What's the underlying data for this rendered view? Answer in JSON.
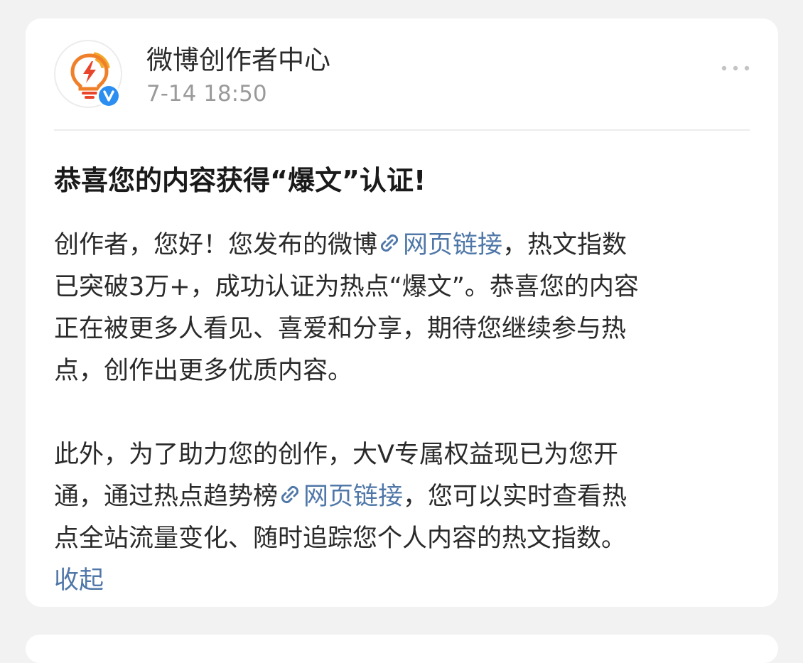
{
  "post": {
    "author": "微博创作者中心",
    "timestamp": "7-14 18:50",
    "title": "恭喜您的内容获得“爆文”认证!",
    "link_label": "网页链接",
    "p1_l1_a": "创作者，您好！您发布的微博",
    "p1_l1_b": "，热文指数",
    "p1_l2": "已突破3万+，成功认证为热点“爆文”。恭喜您的内容",
    "p1_l3": "正在被更多人看见、喜爱和分享，期待您继续参与热",
    "p1_l4": "点，创作出更多优质内容。",
    "p2_l1": "此外，为了助力您的创作，大V专属权益现已为您开",
    "p2_l2_a": "通，通过热点趋势榜",
    "p2_l2_b": "，您可以实时查看热",
    "p2_l3": "点全站流量变化、随时追踪您个人内容的热文指数。",
    "collapse": "收起"
  },
  "icons": {
    "avatar": "lightbulb-lightning-icon",
    "verified": "verified-v-badge-icon",
    "more": "more-dots-icon",
    "link": "link-chain-icon"
  },
  "colors": {
    "link": "#4f77a8",
    "background": "#f2f2f2",
    "card": "#ffffff",
    "timestamp": "#9a9a9a",
    "avatar_orange": "#f07f2a",
    "avatar_red": "#e8452c",
    "verified_blue": "#2b8ef0"
  }
}
